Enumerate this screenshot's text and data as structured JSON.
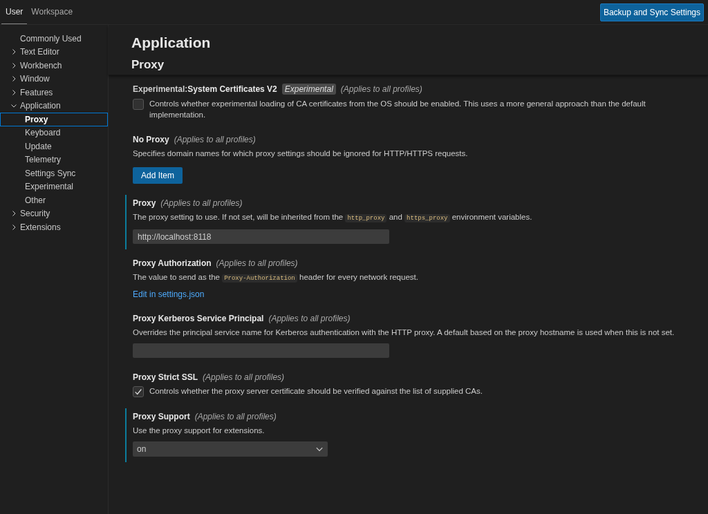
{
  "tabs": [
    {
      "label": "User",
      "selected": true
    },
    {
      "label": "Workspace",
      "selected": false
    }
  ],
  "sync_button": "Backup and Sync Settings",
  "sidebar": {
    "items": [
      {
        "label": "Commonly Used",
        "selected": false
      },
      {
        "label": "Text Editor",
        "expanded": false,
        "selected": false
      },
      {
        "label": "Workbench",
        "expanded": false,
        "selected": false
      },
      {
        "label": "Window",
        "expanded": false,
        "selected": false
      },
      {
        "label": "Features",
        "expanded": false,
        "selected": false
      },
      {
        "label": "Application",
        "expanded": true,
        "selected": false,
        "children": [
          {
            "label": "Proxy",
            "selected": true
          },
          {
            "label": "Keyboard",
            "selected": false
          },
          {
            "label": "Update",
            "selected": false
          },
          {
            "label": "Telemetry",
            "selected": false
          },
          {
            "label": "Settings Sync",
            "selected": false
          },
          {
            "label": "Experimental",
            "selected": false
          },
          {
            "label": "Other",
            "selected": false
          }
        ]
      },
      {
        "label": "Security",
        "expanded": false,
        "selected": false
      },
      {
        "label": "Extensions",
        "expanded": false,
        "selected": false
      }
    ]
  },
  "heading": "Application",
  "subheading": "Proxy",
  "settings": [
    {
      "kind": "checkbox",
      "category": "Experimental:",
      "title": "System Certificates V2",
      "tag": "Experimental",
      "scope": "(Applies to all profiles)",
      "modified": false,
      "description": [
        {
          "text": "Controls whether experimental loading of CA certificates from the OS should be enabled. This uses a more general approach than the default implementation.",
          "code": false
        }
      ],
      "checked": false
    },
    {
      "kind": "list",
      "title": "No Proxy",
      "scope": "(Applies to all profiles)",
      "modified": false,
      "description": [
        {
          "text": "Specifies domain names for which proxy settings should be ignored for HTTP/HTTPS requests.",
          "code": false
        }
      ],
      "button": "Add Item"
    },
    {
      "kind": "text",
      "title": "Proxy",
      "scope": "(Applies to all profiles)",
      "modified": true,
      "description": [
        {
          "text": "The proxy setting to use. If not set, will be inherited from the",
          "code": false
        },
        {
          "text": "http_proxy",
          "code": true
        },
        {
          "text": "and",
          "code": false
        },
        {
          "text": "https_proxy",
          "code": true
        },
        {
          "text": "environment variables.",
          "code": false
        }
      ],
      "value": "http://localhost:8118"
    },
    {
      "kind": "link",
      "title": "Proxy Authorization",
      "scope": "(Applies to all profiles)",
      "modified": false,
      "description": [
        {
          "text": "The value to send as the",
          "code": false
        },
        {
          "text": "Proxy-Authorization",
          "code": true
        },
        {
          "text": "header for every network request.",
          "code": false
        }
      ],
      "link": "Edit in settings.json"
    },
    {
      "kind": "text",
      "title": "Proxy Kerberos Service Principal",
      "scope": "(Applies to all profiles)",
      "modified": false,
      "description": [
        {
          "text": "Overrides the principal service name for Kerberos authentication with the HTTP proxy. A default based on the proxy hostname is used when this is not set.",
          "code": false
        }
      ]
    },
    {
      "kind": "checkbox",
      "title": "Proxy Strict SSL",
      "scope": "(Applies to all profiles)",
      "modified": false,
      "description": [
        {
          "text": "Controls whether the proxy server certificate should be verified against the list of supplied CAs.",
          "code": false
        }
      ],
      "checked": true
    },
    {
      "kind": "select",
      "title": "Proxy Support",
      "scope": "(Applies to all profiles)",
      "modified": true,
      "description": [
        {
          "text": "Use the proxy support for extensions.",
          "code": false
        }
      ],
      "value": "on"
    }
  ]
}
